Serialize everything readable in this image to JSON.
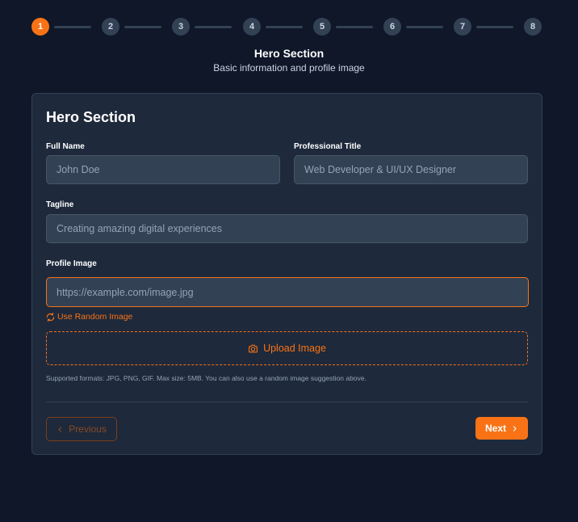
{
  "stepper": {
    "steps": [
      "1",
      "2",
      "3",
      "4",
      "5",
      "6",
      "7",
      "8"
    ],
    "active_step": 1,
    "title": "Hero Section",
    "subtitle": "Basic information and profile image"
  },
  "card": {
    "title": "Hero Section",
    "full_name": {
      "label": "Full Name",
      "placeholder": "John Doe",
      "value": ""
    },
    "professional_title": {
      "label": "Professional Title",
      "placeholder": "Web Developer & UI/UX Designer",
      "value": ""
    },
    "tagline": {
      "label": "Tagline",
      "placeholder": "Creating amazing digital experiences",
      "value": ""
    },
    "profile_image": {
      "label": "Profile Image",
      "placeholder": "https://example.com/image.jpg",
      "value": ""
    },
    "random_image_label": "Use Random Image",
    "random_icon": "refresh-icon",
    "upload_label": "Upload Image",
    "upload_icon": "camera-icon",
    "help_text": "Supported formats: JPG, PNG, GIF. Max size: 5MB. You can also use a random image suggestion above.",
    "previous_label": "Previous",
    "next_label": "Next"
  },
  "colors": {
    "accent": "#f97316",
    "background": "#0f1729",
    "card": "#1e293b",
    "input": "#334155"
  }
}
